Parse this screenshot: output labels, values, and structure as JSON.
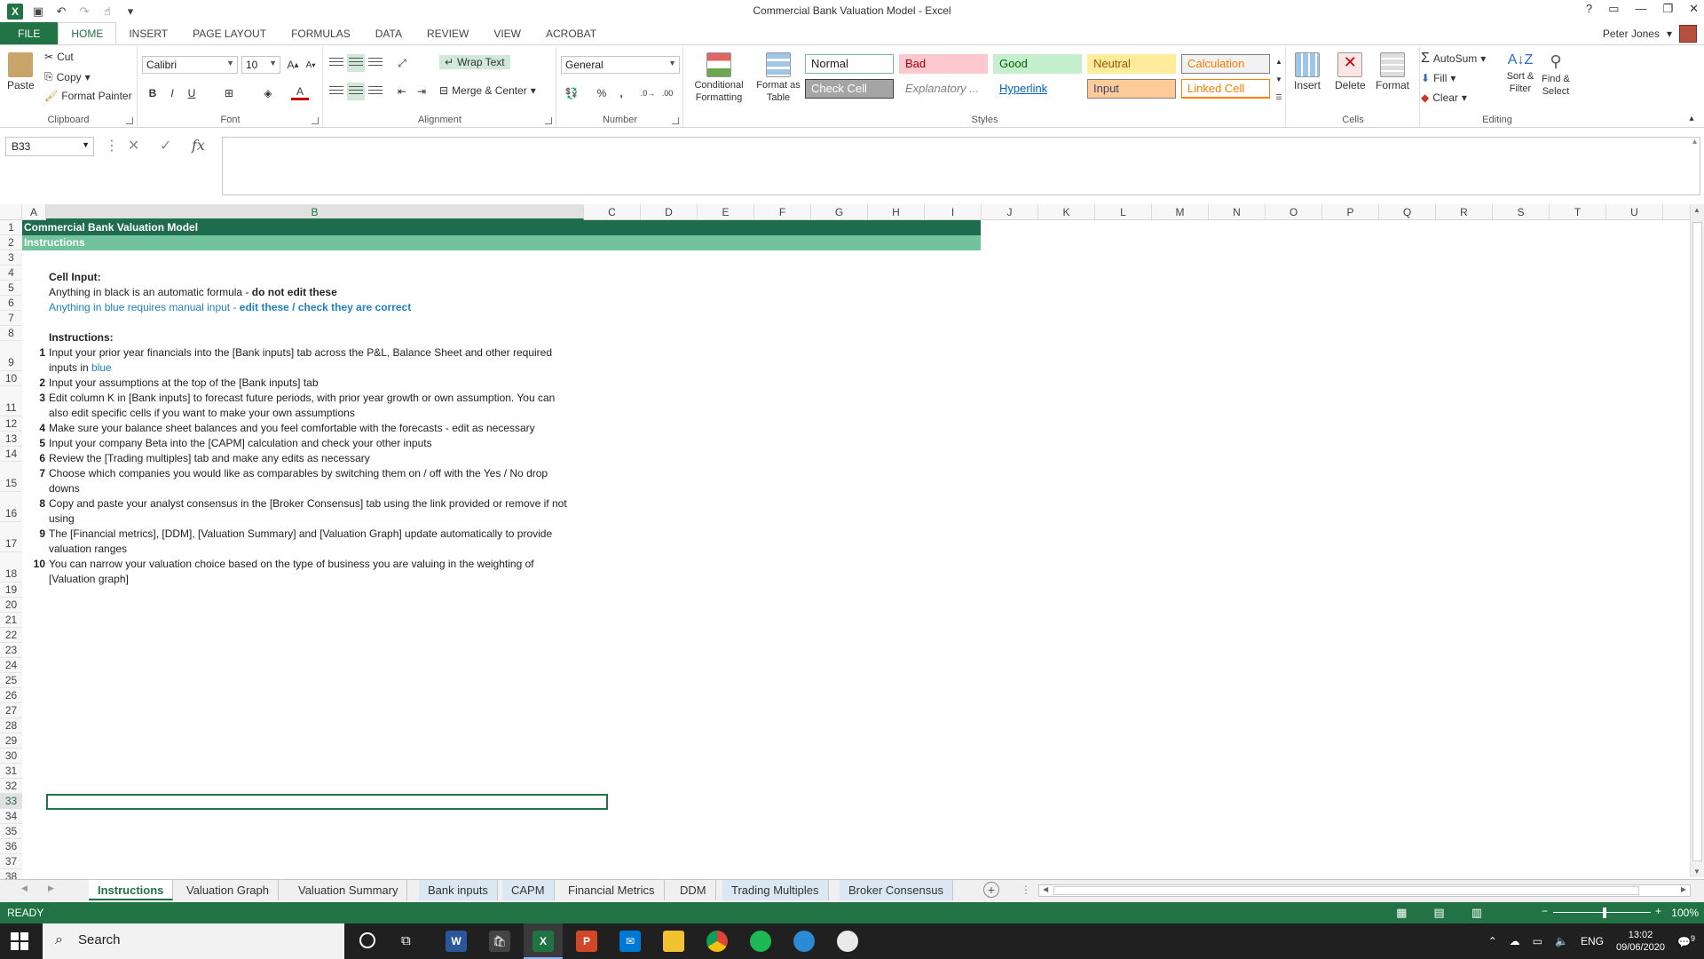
{
  "window": {
    "title": "Commercial Bank Valuation Model - Excel",
    "help": "?",
    "minimize": "—",
    "restore": "❐",
    "close": "✕"
  },
  "ribbon_tabs": [
    "FILE",
    "HOME",
    "INSERT",
    "PAGE LAYOUT",
    "FORMULAS",
    "DATA",
    "REVIEW",
    "VIEW",
    "ACROBAT"
  ],
  "user": {
    "name": "Peter Jones"
  },
  "clipboard": {
    "paste": "Paste",
    "cut": "Cut",
    "copy": "Copy",
    "format_painter": "Format Painter",
    "label": "Clipboard"
  },
  "font": {
    "name": "Calibri",
    "size": "10",
    "label": "Font",
    "bold": "B",
    "italic": "I",
    "underline": "U"
  },
  "alignment": {
    "wrap": "Wrap Text",
    "merge": "Merge & Center",
    "label": "Alignment"
  },
  "number": {
    "format": "General",
    "label": "Number",
    "percent": "%",
    "comma": ","
  },
  "styles": {
    "conditional": "Conditional Formatting",
    "format_table": "Format as Table",
    "label": "Styles",
    "cells": [
      {
        "name": "Normal",
        "bg": "#ffffff",
        "fg": "#222222",
        "border": "#7cb98f"
      },
      {
        "name": "Bad",
        "bg": "#ffc7ce",
        "fg": "#9c0006",
        "border": "#ffc7ce"
      },
      {
        "name": "Good",
        "bg": "#c6efce",
        "fg": "#006100",
        "border": "#c6efce"
      },
      {
        "name": "Neutral",
        "bg": "#ffeb9c",
        "fg": "#9c5700",
        "border": "#ffeb9c"
      },
      {
        "name": "Calculation",
        "bg": "#f2f2f2",
        "fg": "#fa7d00",
        "border": "#7f7f7f"
      },
      {
        "name": "Check Cell",
        "bg": "#a5a5a5",
        "fg": "#ffffff",
        "border": "#3f3f3f"
      },
      {
        "name": "Explanatory ...",
        "bg": "#ffffff",
        "fg": "#7f7f7f",
        "border": "#ffffff"
      },
      {
        "name": "Hyperlink",
        "bg": "#ffffff",
        "fg": "#0563c1",
        "border": "#ffffff"
      },
      {
        "name": "Input",
        "bg": "#ffcc99",
        "fg": "#3f3f76",
        "border": "#7f7f7f"
      },
      {
        "name": "Linked Cell",
        "bg": "#ffffff",
        "fg": "#fa7d00",
        "border": "#ff8001"
      }
    ]
  },
  "cells_group": {
    "insert": "Insert",
    "delete": "Delete",
    "format": "Format",
    "label": "Cells"
  },
  "editing": {
    "autosum": "AutoSum",
    "fill": "Fill",
    "clear": "Clear",
    "sort": "Sort & Filter",
    "find": "Find & Select",
    "label": "Editing"
  },
  "formula_bar": {
    "name_box": "B33",
    "fx": "fx",
    "value": ""
  },
  "columns": [
    "A",
    "B",
    "C",
    "D",
    "E",
    "F",
    "G",
    "H",
    "I",
    "J",
    "K",
    "L",
    "M",
    "N",
    "O",
    "P",
    "Q",
    "R",
    "S",
    "T",
    "U"
  ],
  "rows": [
    "1",
    "2",
    "3",
    "4",
    "5",
    "6",
    "7",
    "8",
    "9",
    "10",
    "11",
    "12",
    "13",
    "14",
    "15",
    "16",
    "17",
    "18",
    "19",
    "20",
    "21",
    "22",
    "23",
    "24",
    "25",
    "26",
    "27",
    "28",
    "29",
    "30",
    "31",
    "32",
    "33",
    "34",
    "35",
    "36",
    "37",
    "38"
  ],
  "sheet": {
    "title": "Commercial Bank Valuation Model",
    "subtitle": "Instructions",
    "cell_input_heading": "Cell Input:",
    "black_text": "Anything in black is an automatic formula - ",
    "black_bold": "do not edit these",
    "blue_text": "Anything in blue requires manual input - ",
    "blue_bold": "edit these / check they are correct",
    "instructions_heading": "Instructions:",
    "items": [
      {
        "n": "1",
        "l1": "Input your prior year financials into the [Bank inputs] tab across the P&L, Balance Sheet and other required",
        "l2": "inputs in ",
        "l2blue": "blue"
      },
      {
        "n": "2",
        "l1": "Input your assumptions at the top of the [Bank inputs] tab",
        "l2": "",
        "l2blue": ""
      },
      {
        "n": "3",
        "l1": "Edit column K in [Bank inputs] to forecast future periods, with prior year growth or own assumption. You can",
        "l2": "also edit specific cells if you want to make your own assumptions",
        "l2blue": ""
      },
      {
        "n": "4",
        "l1": "Make sure your balance sheet balances and you feel comfortable with the forecasts - edit as necessary",
        "l2": "",
        "l2blue": ""
      },
      {
        "n": "5",
        "l1": "Input your company Beta into the [CAPM] calculation and check your other inputs",
        "l2": "",
        "l2blue": ""
      },
      {
        "n": "6",
        "l1": "Review the [Trading multiples] tab and make any edits as necessary",
        "l2": "",
        "l2blue": ""
      },
      {
        "n": "7",
        "l1": "Choose which companies you would like as comparables by switching them on / off with the Yes / No drop",
        "l2": "downs",
        "l2blue": ""
      },
      {
        "n": "8",
        "l1": "Copy and paste your analyst consensus in the [Broker Consensus] tab using the link provided or remove if not",
        "l2": "using",
        "l2blue": ""
      },
      {
        "n": "9",
        "l1": "The [Financial metrics], [DDM], [Valuation Summary] and [Valuation Graph] update automatically to provide",
        "l2": "valuation ranges",
        "l2blue": ""
      },
      {
        "n": "10",
        "l1": "You can narrow your valuation choice based on the type of business you are valuing in the weighting of",
        "l2": "[Valuation graph]",
        "l2blue": ""
      }
    ]
  },
  "sheet_tabs": [
    "Instructions",
    "Valuation Graph",
    "Valuation Summary",
    "Bank inputs",
    "CAPM",
    "Financial Metrics",
    "DDM",
    "Trading Multiples",
    "Broker Consensus"
  ],
  "status": {
    "ready": "READY",
    "zoom": "100%"
  },
  "taskbar": {
    "search": "Search",
    "lang": "ENG",
    "time": "13:02",
    "date": "09/06/2020",
    "notifications": "9"
  },
  "colors": {
    "excel_green": "#217346",
    "band_dark": "#1f6b4e",
    "band_light": "#70c39b",
    "input_blue": "#1f7fc3"
  }
}
